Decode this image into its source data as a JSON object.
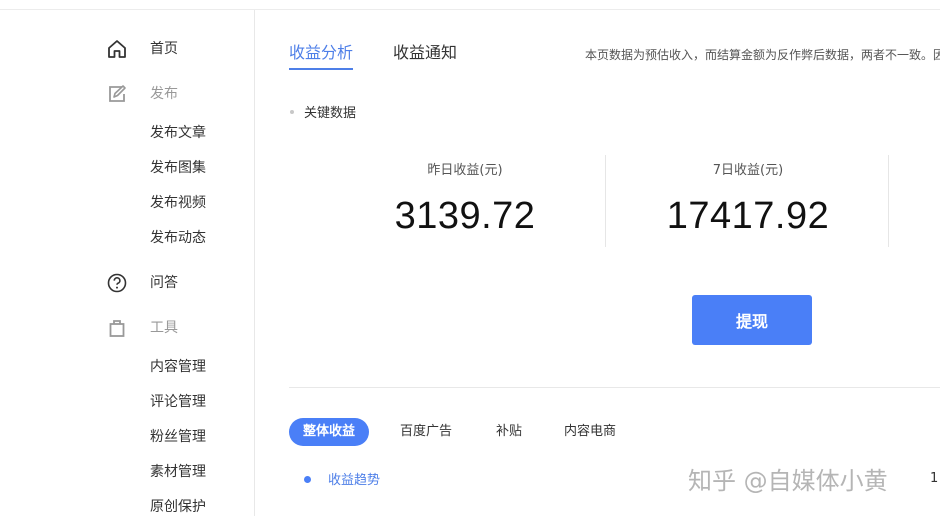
{
  "sidebar": {
    "items": [
      {
        "label": "首页",
        "icon": "home-icon"
      },
      {
        "label": "发布",
        "icon": "edit-icon"
      },
      {
        "label": "发布文章"
      },
      {
        "label": "发布图集"
      },
      {
        "label": "发布视频"
      },
      {
        "label": "发布动态"
      },
      {
        "label": "问答",
        "icon": "question-icon"
      },
      {
        "label": "工具",
        "icon": "bag-icon"
      },
      {
        "label": "内容管理"
      },
      {
        "label": "评论管理"
      },
      {
        "label": "粉丝管理"
      },
      {
        "label": "素材管理"
      },
      {
        "label": "原创保护"
      }
    ]
  },
  "tabs": {
    "items": [
      {
        "label": "收益分析"
      },
      {
        "label": "收益通知"
      }
    ],
    "active_index": 0
  },
  "notice": "本页数据为预估收入，而结算金额为反作弊后数据，两者不一致。因",
  "key_data": {
    "title": "关键数据",
    "stats": [
      {
        "label": "昨日收益(元)",
        "value": "3139.72"
      },
      {
        "label": "7日收益(元)",
        "value": "17417.92"
      }
    ],
    "withdraw_label": "提现"
  },
  "pill_tabs": {
    "items": [
      {
        "label": "整体收益"
      },
      {
        "label": "百度广告"
      },
      {
        "label": "补贴"
      },
      {
        "label": "内容电商"
      }
    ],
    "active_index": 0
  },
  "trend_label": "收益趋势",
  "watermark": "知乎 @自媒体小黄",
  "cut_number": "1",
  "colors": {
    "accent": "#4a7ff7",
    "tab_active": "#4e7fe8",
    "text": "#333333",
    "muted": "#999999"
  }
}
